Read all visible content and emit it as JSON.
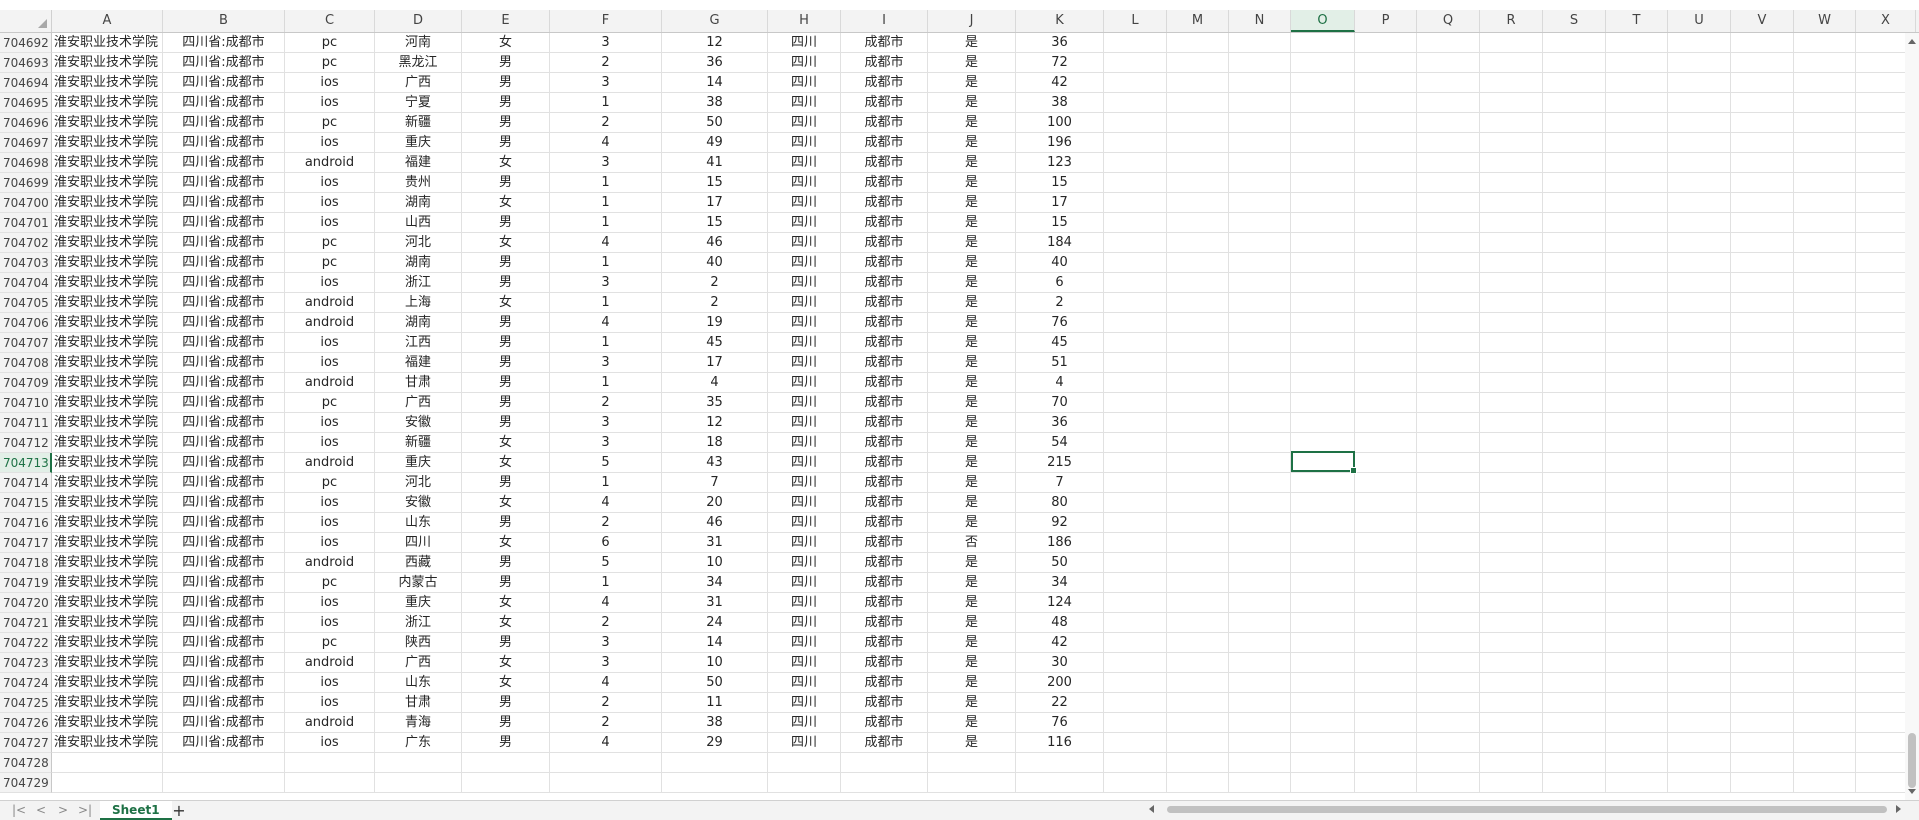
{
  "columns": [
    "A",
    "B",
    "C",
    "D",
    "E",
    "F",
    "G",
    "H",
    "I",
    "J",
    "K",
    "L",
    "M",
    "N",
    "O",
    "P",
    "Q",
    "R",
    "S",
    "T",
    "U",
    "V",
    "W",
    "X"
  ],
  "active_column": "O",
  "active_row": "704713",
  "rows": [
    {
      "n": "704692",
      "c": [
        "淮安职业技术学院",
        "四川省:成都市",
        "pc",
        "河南",
        "女",
        "3",
        "12",
        "四川",
        "成都市",
        "是",
        "36"
      ]
    },
    {
      "n": "704693",
      "c": [
        "淮安职业技术学院",
        "四川省:成都市",
        "pc",
        "黑龙江",
        "男",
        "2",
        "36",
        "四川",
        "成都市",
        "是",
        "72"
      ]
    },
    {
      "n": "704694",
      "c": [
        "淮安职业技术学院",
        "四川省:成都市",
        "ios",
        "广西",
        "男",
        "3",
        "14",
        "四川",
        "成都市",
        "是",
        "42"
      ]
    },
    {
      "n": "704695",
      "c": [
        "淮安职业技术学院",
        "四川省:成都市",
        "ios",
        "宁夏",
        "男",
        "1",
        "38",
        "四川",
        "成都市",
        "是",
        "38"
      ]
    },
    {
      "n": "704696",
      "c": [
        "淮安职业技术学院",
        "四川省:成都市",
        "pc",
        "新疆",
        "男",
        "2",
        "50",
        "四川",
        "成都市",
        "是",
        "100"
      ]
    },
    {
      "n": "704697",
      "c": [
        "淮安职业技术学院",
        "四川省:成都市",
        "ios",
        "重庆",
        "男",
        "4",
        "49",
        "四川",
        "成都市",
        "是",
        "196"
      ]
    },
    {
      "n": "704698",
      "c": [
        "淮安职业技术学院",
        "四川省:成都市",
        "android",
        "福建",
        "女",
        "3",
        "41",
        "四川",
        "成都市",
        "是",
        "123"
      ]
    },
    {
      "n": "704699",
      "c": [
        "淮安职业技术学院",
        "四川省:成都市",
        "ios",
        "贵州",
        "男",
        "1",
        "15",
        "四川",
        "成都市",
        "是",
        "15"
      ]
    },
    {
      "n": "704700",
      "c": [
        "淮安职业技术学院",
        "四川省:成都市",
        "ios",
        "湖南",
        "女",
        "1",
        "17",
        "四川",
        "成都市",
        "是",
        "17"
      ]
    },
    {
      "n": "704701",
      "c": [
        "淮安职业技术学院",
        "四川省:成都市",
        "ios",
        "山西",
        "男",
        "1",
        "15",
        "四川",
        "成都市",
        "是",
        "15"
      ]
    },
    {
      "n": "704702",
      "c": [
        "淮安职业技术学院",
        "四川省:成都市",
        "pc",
        "河北",
        "女",
        "4",
        "46",
        "四川",
        "成都市",
        "是",
        "184"
      ]
    },
    {
      "n": "704703",
      "c": [
        "淮安职业技术学院",
        "四川省:成都市",
        "pc",
        "湖南",
        "男",
        "1",
        "40",
        "四川",
        "成都市",
        "是",
        "40"
      ]
    },
    {
      "n": "704704",
      "c": [
        "淮安职业技术学院",
        "四川省:成都市",
        "ios",
        "浙江",
        "男",
        "3",
        "2",
        "四川",
        "成都市",
        "是",
        "6"
      ]
    },
    {
      "n": "704705",
      "c": [
        "淮安职业技术学院",
        "四川省:成都市",
        "android",
        "上海",
        "女",
        "1",
        "2",
        "四川",
        "成都市",
        "是",
        "2"
      ]
    },
    {
      "n": "704706",
      "c": [
        "淮安职业技术学院",
        "四川省:成都市",
        "android",
        "湖南",
        "男",
        "4",
        "19",
        "四川",
        "成都市",
        "是",
        "76"
      ]
    },
    {
      "n": "704707",
      "c": [
        "淮安职业技术学院",
        "四川省:成都市",
        "ios",
        "江西",
        "男",
        "1",
        "45",
        "四川",
        "成都市",
        "是",
        "45"
      ]
    },
    {
      "n": "704708",
      "c": [
        "淮安职业技术学院",
        "四川省:成都市",
        "ios",
        "福建",
        "男",
        "3",
        "17",
        "四川",
        "成都市",
        "是",
        "51"
      ]
    },
    {
      "n": "704709",
      "c": [
        "淮安职业技术学院",
        "四川省:成都市",
        "android",
        "甘肃",
        "男",
        "1",
        "4",
        "四川",
        "成都市",
        "是",
        "4"
      ]
    },
    {
      "n": "704710",
      "c": [
        "淮安职业技术学院",
        "四川省:成都市",
        "pc",
        "广西",
        "男",
        "2",
        "35",
        "四川",
        "成都市",
        "是",
        "70"
      ]
    },
    {
      "n": "704711",
      "c": [
        "淮安职业技术学院",
        "四川省:成都市",
        "ios",
        "安徽",
        "男",
        "3",
        "12",
        "四川",
        "成都市",
        "是",
        "36"
      ]
    },
    {
      "n": "704712",
      "c": [
        "淮安职业技术学院",
        "四川省:成都市",
        "ios",
        "新疆",
        "女",
        "3",
        "18",
        "四川",
        "成都市",
        "是",
        "54"
      ]
    },
    {
      "n": "704713",
      "c": [
        "淮安职业技术学院",
        "四川省:成都市",
        "android",
        "重庆",
        "女",
        "5",
        "43",
        "四川",
        "成都市",
        "是",
        "215"
      ]
    },
    {
      "n": "704714",
      "c": [
        "淮安职业技术学院",
        "四川省:成都市",
        "pc",
        "河北",
        "男",
        "1",
        "7",
        "四川",
        "成都市",
        "是",
        "7"
      ]
    },
    {
      "n": "704715",
      "c": [
        "淮安职业技术学院",
        "四川省:成都市",
        "ios",
        "安徽",
        "女",
        "4",
        "20",
        "四川",
        "成都市",
        "是",
        "80"
      ]
    },
    {
      "n": "704716",
      "c": [
        "淮安职业技术学院",
        "四川省:成都市",
        "ios",
        "山东",
        "男",
        "2",
        "46",
        "四川",
        "成都市",
        "是",
        "92"
      ]
    },
    {
      "n": "704717",
      "c": [
        "淮安职业技术学院",
        "四川省:成都市",
        "ios",
        "四川",
        "女",
        "6",
        "31",
        "四川",
        "成都市",
        "否",
        "186"
      ]
    },
    {
      "n": "704718",
      "c": [
        "淮安职业技术学院",
        "四川省:成都市",
        "android",
        "西藏",
        "男",
        "5",
        "10",
        "四川",
        "成都市",
        "是",
        "50"
      ]
    },
    {
      "n": "704719",
      "c": [
        "淮安职业技术学院",
        "四川省:成都市",
        "pc",
        "内蒙古",
        "男",
        "1",
        "34",
        "四川",
        "成都市",
        "是",
        "34"
      ]
    },
    {
      "n": "704720",
      "c": [
        "淮安职业技术学院",
        "四川省:成都市",
        "ios",
        "重庆",
        "女",
        "4",
        "31",
        "四川",
        "成都市",
        "是",
        "124"
      ]
    },
    {
      "n": "704721",
      "c": [
        "淮安职业技术学院",
        "四川省:成都市",
        "ios",
        "浙江",
        "女",
        "2",
        "24",
        "四川",
        "成都市",
        "是",
        "48"
      ]
    },
    {
      "n": "704722",
      "c": [
        "淮安职业技术学院",
        "四川省:成都市",
        "pc",
        "陕西",
        "男",
        "3",
        "14",
        "四川",
        "成都市",
        "是",
        "42"
      ]
    },
    {
      "n": "704723",
      "c": [
        "淮安职业技术学院",
        "四川省:成都市",
        "android",
        "广西",
        "女",
        "3",
        "10",
        "四川",
        "成都市",
        "是",
        "30"
      ]
    },
    {
      "n": "704724",
      "c": [
        "淮安职业技术学院",
        "四川省:成都市",
        "ios",
        "山东",
        "女",
        "4",
        "50",
        "四川",
        "成都市",
        "是",
        "200"
      ]
    },
    {
      "n": "704725",
      "c": [
        "淮安职业技术学院",
        "四川省:成都市",
        "ios",
        "甘肃",
        "男",
        "2",
        "11",
        "四川",
        "成都市",
        "是",
        "22"
      ]
    },
    {
      "n": "704726",
      "c": [
        "淮安职业技术学院",
        "四川省:成都市",
        "android",
        "青海",
        "男",
        "2",
        "38",
        "四川",
        "成都市",
        "是",
        "76"
      ]
    },
    {
      "n": "704727",
      "c": [
        "淮安职业技术学院",
        "四川省:成都市",
        "ios",
        "广东",
        "男",
        "4",
        "29",
        "四川",
        "成都市",
        "是",
        "116"
      ]
    },
    {
      "n": "704728",
      "c": []
    },
    {
      "n": "704729",
      "c": []
    }
  ],
  "sheet_tabs": [
    {
      "label": "Sheet1",
      "active": true
    }
  ],
  "add_sheet_label": "+",
  "nav_arrows": [
    "|<",
    "<",
    ">",
    ">|"
  ],
  "accent_color": "#1e7145"
}
